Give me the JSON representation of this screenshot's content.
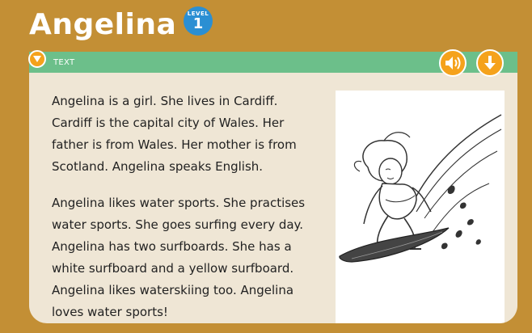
{
  "header": {
    "title": "Angelina",
    "level_word": "LEVEL",
    "level_number": "1"
  },
  "panel": {
    "tab_label": "TEXT",
    "header_color": "#6cbf8a"
  },
  "controls": {
    "toggle_icon": "triangle-down-icon",
    "audio_icon": "speaker-icon",
    "download_icon": "arrow-down-icon",
    "button_color": "#f5a21c"
  },
  "content": {
    "paragraphs": [
      "Angelina is a girl. She lives in Cardiff. Cardiff is the capital city of Wales. Her father is from Wales. Her mother is from Scotland. Angelina speaks English.",
      "Angelina likes water sports. She practises water sports. She goes surfing every day. Angelina has two surfboards. She has a white surfboard and a yellow surfboard. Angelina likes waterskiing too. Angelina loves water sports!"
    ]
  },
  "colors": {
    "background": "#c38f35",
    "panel_background": "#efe6d5",
    "level_badge": "#2b8fd3"
  }
}
